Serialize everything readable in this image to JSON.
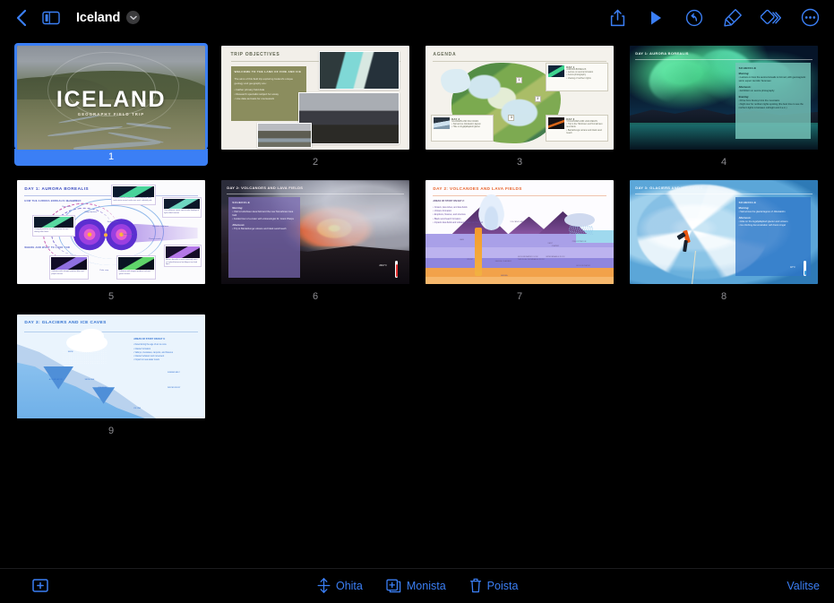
{
  "toolbar": {
    "back_icon": "chevron-left-icon",
    "sidebar_icon": "sidebar-toggle-icon",
    "document_title": "Iceland",
    "title_chevron_icon": "chevron-down-icon",
    "actions": [
      {
        "name": "share-button",
        "icon": "share-icon"
      },
      {
        "name": "play-button",
        "icon": "play-icon"
      },
      {
        "name": "undo-button",
        "icon": "undo-icon"
      },
      {
        "name": "format-button",
        "icon": "paintbrush-icon"
      },
      {
        "name": "animate-button",
        "icon": "animate-icon"
      },
      {
        "name": "more-button",
        "icon": "more-ellipsis-icon"
      }
    ]
  },
  "bottombar": {
    "add_label": "+",
    "add_icon": "add-slide-icon",
    "skip_label": "Ohita",
    "skip_icon": "skip-slide-icon",
    "duplicate_label": "Monista",
    "duplicate_icon": "duplicate-icon",
    "delete_label": "Poista",
    "delete_icon": "trash-icon",
    "select_label": "Valitse"
  },
  "colors": {
    "accent": "#3b7ff5",
    "background": "#000000",
    "slide_number": "#8e8e93",
    "selected_number": "#ffffff"
  },
  "slides": [
    {
      "number": "1",
      "selected": true,
      "title": "ICELAND",
      "subtitle": "GEOGRAPHY FIELD TRIP"
    },
    {
      "number": "2",
      "selected": false,
      "title": "TRIP OBJECTIVES",
      "panel_heading": "WELCOME TO THE LAND OF FIRE AND ICE",
      "panel_body": "The aims of this field trip exploring Iceland's unique geology and geography are:",
      "bullets": [
        "Gather primary field data",
        "Research specialist subject for essay",
        "Use data as basis for coursework"
      ]
    },
    {
      "number": "3",
      "selected": false,
      "title": "AGENDA",
      "pins": [
        "1",
        "2",
        "3"
      ],
      "cards": [
        {
          "label": "DAY 1",
          "subtitle": "AURORA BOREALIS",
          "lines": [
            "Lecture on aurora formation",
            "Aurora photography",
            "Viewing of northern lights"
          ]
        },
        {
          "label": "DAY 2",
          "subtitle": "VOLCANOES AND LAVA FIELDS",
          "lines": [
            "Trip to the Holuhraun and Nornahraun lava fields",
            "Bardarbunga volcano and black sand beach"
          ]
        },
        {
          "label": "DAY 3",
          "subtitle": "GLACIERS AND ICE CAVES",
          "lines": [
            "Sail across Jokulsarlon lagoon",
            "Hike on Eyjafjallajokull glacier"
          ]
        }
      ]
    },
    {
      "number": "4",
      "selected": false,
      "title": "DAY 1: AURORA BOREALIS",
      "panel_heading": "SCHEDULE",
      "sections": [
        {
          "label": "Morning:",
          "items": [
            "Lecture on how the aurora borealis is formed, with geomagnetic storm expert Jennifer Sorensen"
          ]
        },
        {
          "label": "Afternoon:",
          "items": [
            "Exhibition on aurora photography"
          ]
        },
        {
          "label": "Evening:",
          "items": [
            "Drive from Akureyri into the mountains",
            "Night tour for northern lights spotting (the best time to see the northern lights is between midnight and 2 a.m.)"
          ]
        }
      ]
    },
    {
      "number": "5",
      "selected": false,
      "title": "DAY 1: AURORA BOREALIS",
      "subheading_top": "HOW THE AURORA BOREALIS IS FORMED",
      "subheading_bottom": "WHERE AND WHAT TO LOOK FOR",
      "diagram_labels": [
        "Bow shock",
        "Magnetopause",
        "Plasma sheet",
        "Polar cusp",
        "Plasma mantle",
        "Neutral sheet",
        "Magnetic field lines",
        "Solar wind"
      ],
      "callouts": [
        "Charged particles are emitted from the sun during solar flares",
        "These particles penetrate Earth's magnetic field and create auroral ovals over each celestial pole",
        "The collisions create spectacular displays of light called auroras",
        "Aurora borealis is most commonly seen in Iceland between late August and mid April",
        "Collisions with oxygen produce red and green auroras",
        "Collisions with nitrogen produce blue and purple auroras"
      ]
    },
    {
      "number": "6",
      "selected": false,
      "title": "DAY 2: VOLCANOES AND LAVA FIELDS",
      "panel_heading": "SCHEDULE",
      "sections": [
        {
          "label": "Morning:",
          "items": [
            "Visit to Holuhraun lava field and the new Nornahraun lava field",
            "Guided tour of a crater with volcanologist Dr. Grant Phelps"
          ]
        },
        {
          "label": "Afternoon:",
          "items": [
            "Trip to Bardarbunga volcano and black sand beach"
          ]
        }
      ],
      "temperature": "2010° F"
    },
    {
      "number": "7",
      "selected": false,
      "title": "DAY 2: VOLCANOES AND LAVA FIELDS",
      "subheading": "AREAS OF STUDY ON DAY 2:",
      "bullets": [
        "Craters, lava tubes, and lava fields",
        "Volcano formation",
        "Eruptions, fissures, and structure",
        "Black sand beach formation",
        "Impacts lava fields and volcanoes have on the land"
      ],
      "diagram_labels": [
        "VOLCANIC ASH",
        "LAVA",
        "VENT",
        "CRATER",
        "MAGMA",
        "MAGMA CHAMBER",
        "CRUST",
        "PRECIPITATION",
        "PRECIPITATION WEATHER",
        "GROUNDWATER",
        "GROUNDWATER FLOW",
        "THROUGH PERMEABLE ROCK",
        "IMPERMEABLE ROCK"
      ]
    },
    {
      "number": "8",
      "selected": false,
      "title": "DAY 3: GLACIERS AND ICE CAVES",
      "panel_heading": "SCHEDULE",
      "sections": [
        {
          "label": "Morning:",
          "items": [
            "Sail across the glacial lagoon of Jökulsárlón"
          ]
        },
        {
          "label": "Afternoon:",
          "items": [
            "Hike on the Eyjafjallajökull glacier and volcano",
            "Ice climbing demonstration with Kevin Angel"
          ]
        }
      ],
      "temperature": "18° F"
    },
    {
      "number": "9",
      "selected": false,
      "title": "DAY 3: GLACIERS AND ICE CAVES",
      "subheading": "AREAS OF STUDY ON DAY 3:",
      "bullets": [
        "Determining the age of an ice core",
        "Glacier formation",
        "Valleys, crevasses, canyons, and fissures",
        "Glacier behavior and movement",
        "Impact on sea-water levels"
      ],
      "diagram_labels": [
        "SNOW",
        "ACCUMULATION",
        "SNOW LINE",
        "CREVASSE",
        "SUMMER MELT",
        "WINTER FROST",
        "ICE LINE"
      ]
    }
  ]
}
